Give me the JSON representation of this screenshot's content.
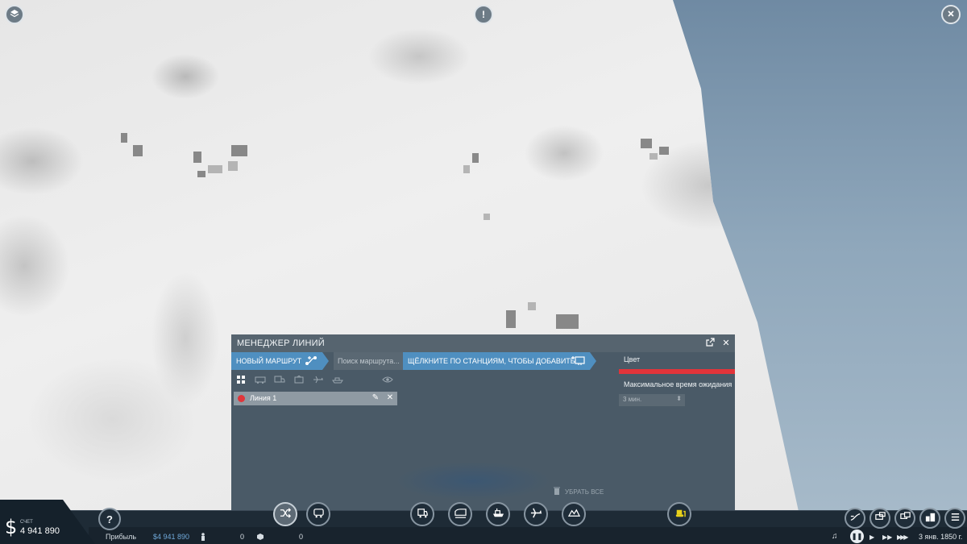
{
  "top_buttons": {
    "left_icon": "layers-icon",
    "center_label": "!",
    "right_icon": "close-icon"
  },
  "line_manager": {
    "title": "МЕНЕДЖЕР ЛИНИЙ",
    "new_route_label": "НОВЫЙ МАРШРУТ",
    "search_placeholder": "Поиск маршрута...",
    "click_stations_label": "ЩЁЛКНИТЕ ПО СТАНЦИЯМ, ЧТОБЫ ДОБАВИТЬ",
    "filters": [
      "grid-icon",
      "bus-icon",
      "truck-icon",
      "tram-icon",
      "train-icon",
      "plane-icon",
      "ship-icon",
      "eye-icon"
    ],
    "lines": [
      {
        "name": "Линия 1",
        "color": "#e0353a"
      }
    ],
    "color_label": "Цвет",
    "line_color": "#e2343a",
    "max_wait_label": "Максимальное время ожидания",
    "max_wait_value": "3 мин.",
    "remove_all_label": "УБРАТЬ ВСЕ"
  },
  "finance": {
    "account_label": "СЧЕТ",
    "account_value": "4 941 890",
    "currency_symbol": "$",
    "profit_label": "Прибыль",
    "profit_value": "$4 941 890",
    "passengers_value": "0",
    "cargo_value": "0"
  },
  "toolbar": {
    "help_label": "?",
    "left_tools": [
      "shuffle-icon",
      "bus-route-icon"
    ],
    "center_tools": [
      "road-vehicle-icon",
      "train-icon",
      "ship-icon",
      "plane-icon",
      "terrain-icon"
    ],
    "bulldozer_tool": "bulldozer-icon",
    "right_tools": [
      "lines-icon",
      "vehicles-icon",
      "chat-icon",
      "towns-icon",
      "menu-icon"
    ]
  },
  "game_controls": {
    "music_icon": "music-icon",
    "pause_label": "❚❚",
    "play_label": "▶",
    "fast_label": "▶▶",
    "faster_label": "▶▶▶",
    "date": "3 янв. 1850 г."
  }
}
